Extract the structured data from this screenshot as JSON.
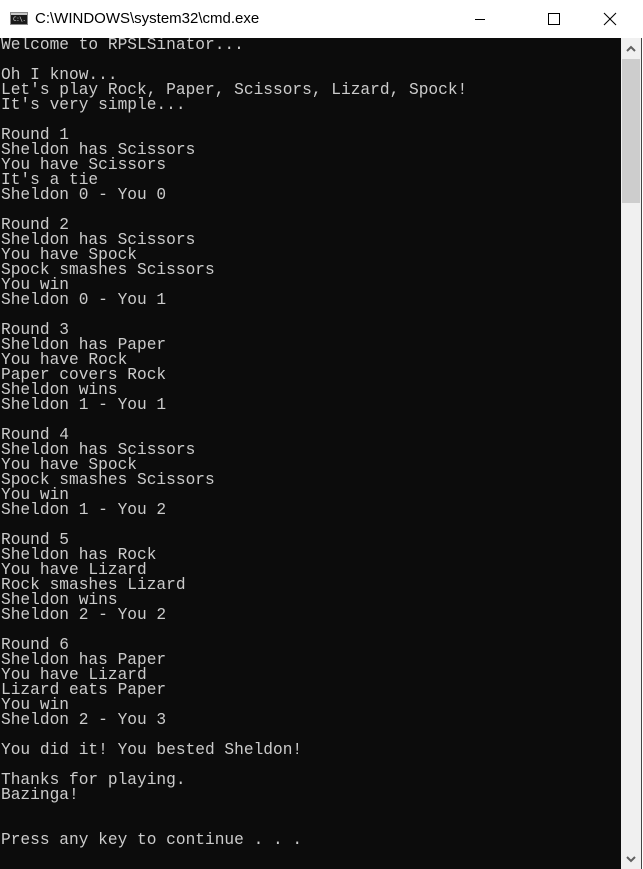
{
  "window": {
    "title": "C:\\WINDOWS\\system32\\cmd.exe",
    "icon": "cmd-icon",
    "icon_text": "C:\\.",
    "controls": {
      "minimize": "minimize-icon",
      "maximize": "maximize-icon",
      "close": "close-icon"
    }
  },
  "console": {
    "background": "#0c0c0c",
    "foreground": "#cccccc",
    "lines": [
      "Welcome to RPSLSinator...",
      "",
      "Oh I know...",
      "Let's play Rock, Paper, Scissors, Lizard, Spock!",
      "It's very simple...",
      "",
      "Round 1",
      "Sheldon has Scissors",
      "You have Scissors",
      "It's a tie",
      "Sheldon 0 - You 0",
      "",
      "Round 2",
      "Sheldon has Scissors",
      "You have Spock",
      "Spock smashes Scissors",
      "You win",
      "Sheldon 0 - You 1",
      "",
      "Round 3",
      "Sheldon has Paper",
      "You have Rock",
      "Paper covers Rock",
      "Sheldon wins",
      "Sheldon 1 - You 1",
      "",
      "Round 4",
      "Sheldon has Scissors",
      "You have Spock",
      "Spock smashes Scissors",
      "You win",
      "Sheldon 1 - You 2",
      "",
      "Round 5",
      "Sheldon has Rock",
      "You have Lizard",
      "Rock smashes Lizard",
      "Sheldon wins",
      "Sheldon 2 - You 2",
      "",
      "Round 6",
      "Sheldon has Paper",
      "You have Lizard",
      "Lizard eats Paper",
      "You win",
      "Sheldon 2 - You 3",
      "",
      "You did it! You bested Sheldon!",
      "",
      "Thanks for playing.",
      "Bazinga!",
      "",
      "",
      "Press any key to continue . . ."
    ]
  },
  "scrollbar": {
    "up_icon": "chevron-up-icon",
    "down_icon": "chevron-down-icon",
    "position_fraction": 0.0
  }
}
